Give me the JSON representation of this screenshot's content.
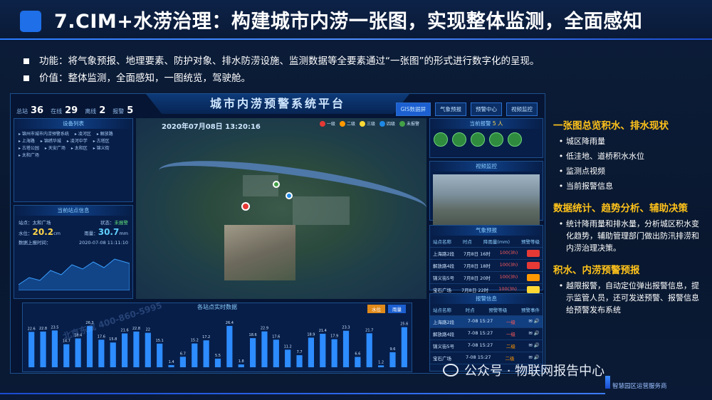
{
  "slide": {
    "title": "7.CIM+水涝治理：构建城市内涝一张图，实现整体监测，全面感知",
    "bullets": [
      "功能：将气象预报、地理要素、防护对象、排水防涝设施、监测数据等全要素通过“一张图”的形式进行数字化的呈现。",
      "价值：整体监测，全面感知，一图统览，驾驶舱。"
    ]
  },
  "dashboard": {
    "title": "城市内涝预警系统平台",
    "tabs": [
      "GIS数据屏",
      "气象预报",
      "预警中心",
      "视频监控"
    ],
    "stats": [
      {
        "label": "总站",
        "value": "36"
      },
      {
        "label": "在线",
        "value": "29"
      },
      {
        "label": "离线",
        "value": "2"
      },
      {
        "label": "报警",
        "value": "5"
      }
    ],
    "date": "2020年07月08日 13:20:16",
    "legend": [
      {
        "label": "一级",
        "color": "#e53935"
      },
      {
        "label": "二级",
        "color": "#ff9800"
      },
      {
        "label": "三级",
        "color": "#fdd835"
      },
      {
        "label": "四级",
        "color": "#1e88e5"
      },
      {
        "label": "未报警",
        "color": "#43a047"
      }
    ],
    "device_list_title": "设备列表",
    "device_items": [
      "锦州市城市内涝预警系统",
      "凌河区",
      "解放路",
      "上海路",
      "锦绣华城",
      "凌河中学",
      "古塔区",
      "古塔公园",
      "天安广场",
      "太和区",
      "锦义街",
      "太和广场"
    ],
    "station_info_title": "当前站点信息",
    "station": {
      "name": "站点：太和广场",
      "status_label": "状态：",
      "status": "未报警",
      "water_label": "水位：",
      "water": "20.2",
      "water_unit": "cm",
      "rain_label": "雨量：",
      "rain": "30.7",
      "rain_unit": "mm",
      "time_label": "数据上报时间：",
      "time": "2020-07-08 11:11:10"
    },
    "alarm_station_title": "当前报警",
    "alarm_station_count": "5 人",
    "video_title": "视频监控",
    "forecast_title": "气象预报",
    "forecast_headers": [
      "站点名称",
      "时点",
      "降雨量(mm)",
      "预警等级"
    ],
    "forecast_rows": [
      [
        "上海路2段",
        "7月8日 16时",
        "100(3h)",
        ""
      ],
      [
        "解放路4段",
        "7月8日 18时",
        "100(3h)",
        ""
      ],
      [
        "锦义街5号",
        "7月8日 20时",
        "100(3h)",
        ""
      ],
      [
        "宝石广场",
        "7月8日 22时",
        "100(3h)",
        ""
      ]
    ],
    "alarm_title": "报警信息",
    "alarm_headers": [
      "站点名称",
      "时点",
      "预警等级",
      "预警事件"
    ],
    "alarm_rows": [
      [
        "上海路2段",
        "7-08 15:27",
        "一级"
      ],
      [
        "解放路4段",
        "7-08 15:27",
        "一级"
      ],
      [
        "锦义街5号",
        "7-08 15:27",
        "二级"
      ],
      [
        "宝石广场",
        "7-08 15:27",
        "二级"
      ]
    ],
    "bar_title": "各站点实时数据",
    "bar_buttons": [
      "水位",
      "雨量"
    ],
    "watermark": "北京东成 400-860-5995"
  },
  "chart_data": {
    "type": "bar",
    "title": "各站点实时数据",
    "values": [
      22.6,
      22.8,
      23.5,
      14.7,
      18.4,
      26.3,
      17.6,
      15.8,
      21.6,
      22.8,
      22.0,
      15.1,
      1.4,
      6.7,
      15.2,
      17.2,
      5.5,
      26.4,
      1.8,
      18.6,
      22.9,
      17.6,
      11.2,
      7.7,
      18.9,
      21.4,
      17.9,
      23.3,
      6.6,
      21.7,
      1.2,
      9.6,
      25.6
    ]
  },
  "right": {
    "sections": [
      {
        "head": "一张图总览积水、排水现状",
        "items": [
          "城区降雨量",
          "低洼地、道桥积水水位",
          "监测点视频",
          "当前报警信息"
        ]
      },
      {
        "head": "数据统计、趋势分析、辅助决策",
        "items": [
          "统计降雨量和排水量，分析城区积水变化趋势，辅助管理部门做出防汛排涝和内涝治理决策。"
        ]
      },
      {
        "head": "积水、内涝预警预报",
        "items": [
          "越限报警，自动定位弹出报警信息，提示监管人员，还可发送预警、报警信息给预警发布系统"
        ]
      }
    ]
  },
  "footer": {
    "wechat": "公众号 · 物联网报告中心",
    "brand": "智慧园区运营服务商"
  }
}
